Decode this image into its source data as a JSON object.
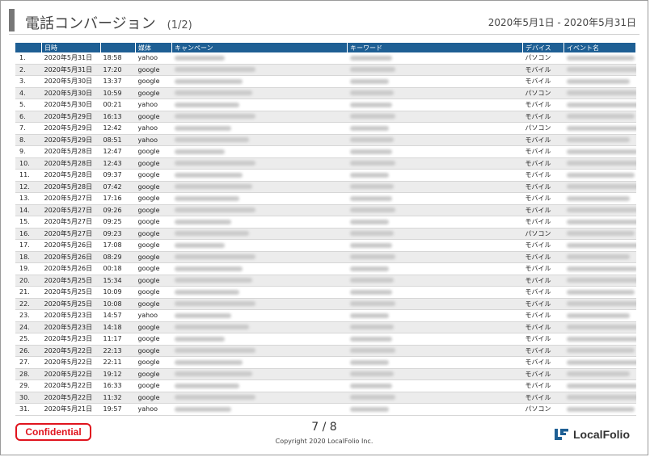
{
  "title": "電話コンバージョン",
  "page_part": "(1/2)",
  "date_range": "2020年5月1日 - 2020年5月31日",
  "columns": [
    "",
    "日時",
    "",
    "媒体",
    "キャンペーン",
    "キーワード",
    "デバイス",
    "イベント名"
  ],
  "rows": [
    {
      "num": "1.",
      "date": "2020年5月31日",
      "time": "18:58",
      "media": "yahoo",
      "device": "パソコン"
    },
    {
      "num": "2.",
      "date": "2020年5月31日",
      "time": "17:20",
      "media": "google",
      "device": "モバイル"
    },
    {
      "num": "3.",
      "date": "2020年5月30日",
      "time": "13:37",
      "media": "google",
      "device": "モバイル"
    },
    {
      "num": "4.",
      "date": "2020年5月30日",
      "time": "10:59",
      "media": "google",
      "device": "パソコン"
    },
    {
      "num": "5.",
      "date": "2020年5月30日",
      "time": "00:21",
      "media": "yahoo",
      "device": "モバイル"
    },
    {
      "num": "6.",
      "date": "2020年5月29日",
      "time": "16:13",
      "media": "google",
      "device": "モバイル"
    },
    {
      "num": "7.",
      "date": "2020年5月29日",
      "time": "12:42",
      "media": "yahoo",
      "device": "パソコン"
    },
    {
      "num": "8.",
      "date": "2020年5月29日",
      "time": "08:51",
      "media": "yahoo",
      "device": "モバイル"
    },
    {
      "num": "9.",
      "date": "2020年5月28日",
      "time": "12:47",
      "media": "google",
      "device": "モバイル"
    },
    {
      "num": "10.",
      "date": "2020年5月28日",
      "time": "12:43",
      "media": "google",
      "device": "モバイル"
    },
    {
      "num": "11.",
      "date": "2020年5月28日",
      "time": "09:37",
      "media": "google",
      "device": "モバイル"
    },
    {
      "num": "12.",
      "date": "2020年5月28日",
      "time": "07:42",
      "media": "google",
      "device": "モバイル"
    },
    {
      "num": "13.",
      "date": "2020年5月27日",
      "time": "17:16",
      "media": "google",
      "device": "モバイル"
    },
    {
      "num": "14.",
      "date": "2020年5月27日",
      "time": "09:26",
      "media": "google",
      "device": "モバイル"
    },
    {
      "num": "15.",
      "date": "2020年5月27日",
      "time": "09:25",
      "media": "google",
      "device": "モバイル"
    },
    {
      "num": "16.",
      "date": "2020年5月27日",
      "time": "09:23",
      "media": "google",
      "device": "パソコン"
    },
    {
      "num": "17.",
      "date": "2020年5月26日",
      "time": "17:08",
      "media": "google",
      "device": "モバイル"
    },
    {
      "num": "18.",
      "date": "2020年5月26日",
      "time": "08:29",
      "media": "google",
      "device": "モバイル"
    },
    {
      "num": "19.",
      "date": "2020年5月26日",
      "time": "00:18",
      "media": "google",
      "device": "モバイル"
    },
    {
      "num": "20.",
      "date": "2020年5月25日",
      "time": "15:34",
      "media": "google",
      "device": "モバイル"
    },
    {
      "num": "21.",
      "date": "2020年5月25日",
      "time": "10:09",
      "media": "google",
      "device": "モバイル"
    },
    {
      "num": "22.",
      "date": "2020年5月25日",
      "time": "10:08",
      "media": "google",
      "device": "モバイル"
    },
    {
      "num": "23.",
      "date": "2020年5月23日",
      "time": "14:57",
      "media": "yahoo",
      "device": "モバイル"
    },
    {
      "num": "24.",
      "date": "2020年5月23日",
      "time": "14:18",
      "media": "google",
      "device": "モバイル"
    },
    {
      "num": "25.",
      "date": "2020年5月23日",
      "time": "11:17",
      "media": "google",
      "device": "モバイル"
    },
    {
      "num": "26.",
      "date": "2020年5月22日",
      "time": "22:13",
      "media": "google",
      "device": "モバイル"
    },
    {
      "num": "27.",
      "date": "2020年5月22日",
      "time": "22:11",
      "media": "google",
      "device": "モバイル"
    },
    {
      "num": "28.",
      "date": "2020年5月22日",
      "time": "19:12",
      "media": "google",
      "device": "モバイル"
    },
    {
      "num": "29.",
      "date": "2020年5月22日",
      "time": "16:33",
      "media": "google",
      "device": "モバイル"
    },
    {
      "num": "30.",
      "date": "2020年5月22日",
      "time": "11:32",
      "media": "google",
      "device": "モバイル"
    },
    {
      "num": "31.",
      "date": "2020年5月21日",
      "time": "19:57",
      "media": "yahoo",
      "device": "パソコン"
    }
  ],
  "footer": {
    "confidential": "Confidential",
    "page_number": "7 / 8",
    "copyright": "Copyright 2020 LocalFolio Inc.",
    "logo_text": "LocalFolio"
  },
  "colors": {
    "header_bg": "#1e5f94",
    "confidential_red": "#e0141e",
    "accent_bar": "#777777"
  }
}
